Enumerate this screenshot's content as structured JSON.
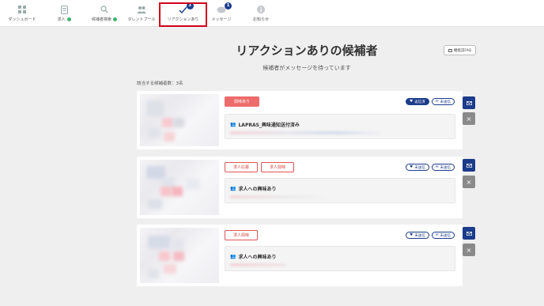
{
  "nav": {
    "items": [
      {
        "label": "ダッシュボード",
        "icon": "dashboard-icon",
        "dot": false
      },
      {
        "label": "求人",
        "icon": "document-icon",
        "dot": true
      },
      {
        "label": "候補者検索",
        "icon": "search-icon",
        "dot": true
      },
      {
        "label": "タレントプール",
        "icon": "people-icon",
        "dot": false
      },
      {
        "label": "リアクションあり",
        "icon": "check-icon",
        "badge": "3"
      },
      {
        "label": "メッセージ",
        "icon": "chat-icon",
        "badge": "1"
      },
      {
        "label": "お知らせ",
        "icon": "info-icon",
        "dot": false
      }
    ]
  },
  "header": {
    "title": "リアクションありの候補者",
    "subtitle": "候補者がメッセージを待っています",
    "faq": "機能説FAQ"
  },
  "count_text": "該当する候補者数：3名",
  "cards": [
    {
      "tags": [
        {
          "label": "興味あり",
          "style": "filled"
        }
      ],
      "pills": [
        {
          "label": "返信済",
          "icon": "heart-icon",
          "filled": true
        },
        {
          "label": "未送信",
          "icon": "mail-icon",
          "filled": false
        }
      ],
      "message_title": "LAPRAS_興味通知送付済み"
    },
    {
      "tags": [
        {
          "label": "求人応募",
          "style": "outline"
        },
        {
          "label": "求人興味",
          "style": "outline"
        }
      ],
      "pills": [
        {
          "label": "未送信",
          "icon": "heart-icon",
          "filled": false
        },
        {
          "label": "未送信",
          "icon": "mail-icon",
          "filled": false
        }
      ],
      "message_title": "求人への興味あり"
    },
    {
      "tags": [
        {
          "label": "求人興味",
          "style": "outline"
        }
      ],
      "pills": [
        {
          "label": "未送信",
          "icon": "heart-icon",
          "filled": false
        },
        {
          "label": "未送信",
          "icon": "mail-icon",
          "filled": false
        }
      ],
      "message_title": "求人への興味あり"
    }
  ],
  "colors": {
    "accent": "#1b3c8a",
    "highlight": "#d0021b",
    "tag_red": "#ee6b6b"
  }
}
